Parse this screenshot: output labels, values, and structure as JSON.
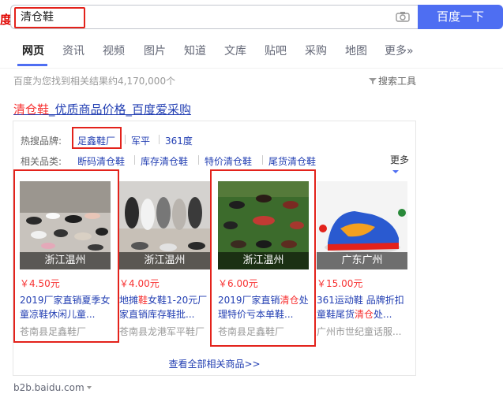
{
  "header": {
    "logo_fragment": "度",
    "search_value": "清仓鞋",
    "search_button": "百度一下"
  },
  "tabs": [
    "网页",
    "资讯",
    "视频",
    "图片",
    "知道",
    "文库",
    "贴吧",
    "采购",
    "地图",
    "更多»"
  ],
  "result_count": "百度为您找到相关结果约4,170,000个",
  "search_tools": "搜索工具",
  "result": {
    "title_highlight": "清仓鞋",
    "title_rest": "_优质商品价格_百度爱采购",
    "hot_brands_label": "热搜品牌:",
    "hot_brands": [
      "足鑫鞋厂",
      "军平",
      "361度"
    ],
    "related_label": "相关品类:",
    "related": [
      "断码清仓鞋",
      "库存清仓鞋",
      "特价清仓鞋",
      "尾货清仓鞋"
    ],
    "more": "更多",
    "products": [
      {
        "location": "浙江温州",
        "price": "￥4.50元",
        "title_a": "2019厂家直销夏季女童凉鞋休闲儿童...",
        "title_hl": "",
        "title_b": "",
        "seller": "苍南县足鑫鞋厂"
      },
      {
        "location": "浙江温州",
        "price": "￥4.00元",
        "title_a": "地摊",
        "title_hl": "鞋",
        "title_b": "女鞋1-20元厂家直销库存鞋批...",
        "seller": "苍南县龙港军平鞋厂"
      },
      {
        "location": "浙江温州",
        "price": "￥6.00元",
        "title_a": "2019厂家直销",
        "title_hl": "清仓",
        "title_b": "处理特价亏本单鞋...",
        "seller": "苍南县足鑫鞋厂"
      },
      {
        "location": "广东广州",
        "price": "￥15.00元",
        "title_a": "361运动鞋 品牌折扣童鞋尾货",
        "title_hl": "清仓",
        "title_b": "处...",
        "seller": "广州市世纪童话服..."
      }
    ],
    "view_all": "查看全部相关商品>>",
    "url": "b2b.baidu.com"
  },
  "colors": {
    "accent": "#4e6ef2",
    "link": "#2440b3",
    "highlight": "#f73131",
    "annotation": "#e3221b"
  }
}
